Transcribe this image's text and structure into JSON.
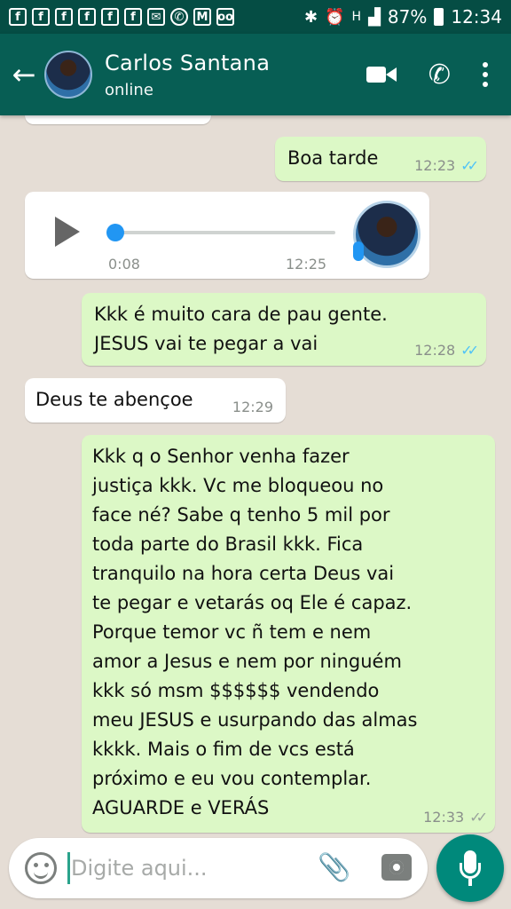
{
  "status_bar": {
    "notification_icons": [
      "f",
      "f",
      "f",
      "f",
      "f",
      "f",
      "mail-icon",
      "whatsapp-icon",
      "gmail-icon",
      "voicemail-icon"
    ],
    "battery": "87%",
    "time": "12:34",
    "signal_label": "H"
  },
  "header": {
    "contact_name": "Carlos Santana",
    "contact_status": "online"
  },
  "messages": [
    {
      "type": "out",
      "text": "Boa tarde",
      "time": "12:23",
      "ticks": "read"
    },
    {
      "type": "voice_in",
      "duration": "0:08",
      "time": "12:25"
    },
    {
      "type": "out",
      "text": "Kkk é muito cara de pau gente.\nJESUS  vai te pegar  a vai",
      "time": "12:28",
      "ticks": "read"
    },
    {
      "type": "in",
      "text": "Deus te abençoe",
      "time": "12:29"
    },
    {
      "type": "out",
      "text": "Kkk q o Senhor  venha fazer\njustiça  kkk. Vc me bloqueou  no\nface né? Sabe q tenho 5 mil por\ntoda  parte do Brasil  kkk. Fica\ntranquilo  na hora  certa Deus vai\nte pegar e vetarás oq Ele é capaz.\nPorque temor vc ñ tem e nem\namor a Jesus e nem por ninguém\nkkk só msm $$$$$$ vendendo\nmeu JESUS e usurpando das almas\nkkkk. Mais o fim de vcs está\npróximo e eu vou contemplar.\nAGUARDE  e VERÁS",
      "time": "12:33",
      "ticks": "delivered"
    }
  ],
  "input": {
    "placeholder": "Digite aqui..."
  },
  "colors": {
    "header": "#075e54",
    "status_bar": "#054d44",
    "outgoing_bubble": "#dcf8c6",
    "incoming_bubble": "#ffffff",
    "chat_background": "#e5ddd5",
    "fab": "#00897b"
  }
}
